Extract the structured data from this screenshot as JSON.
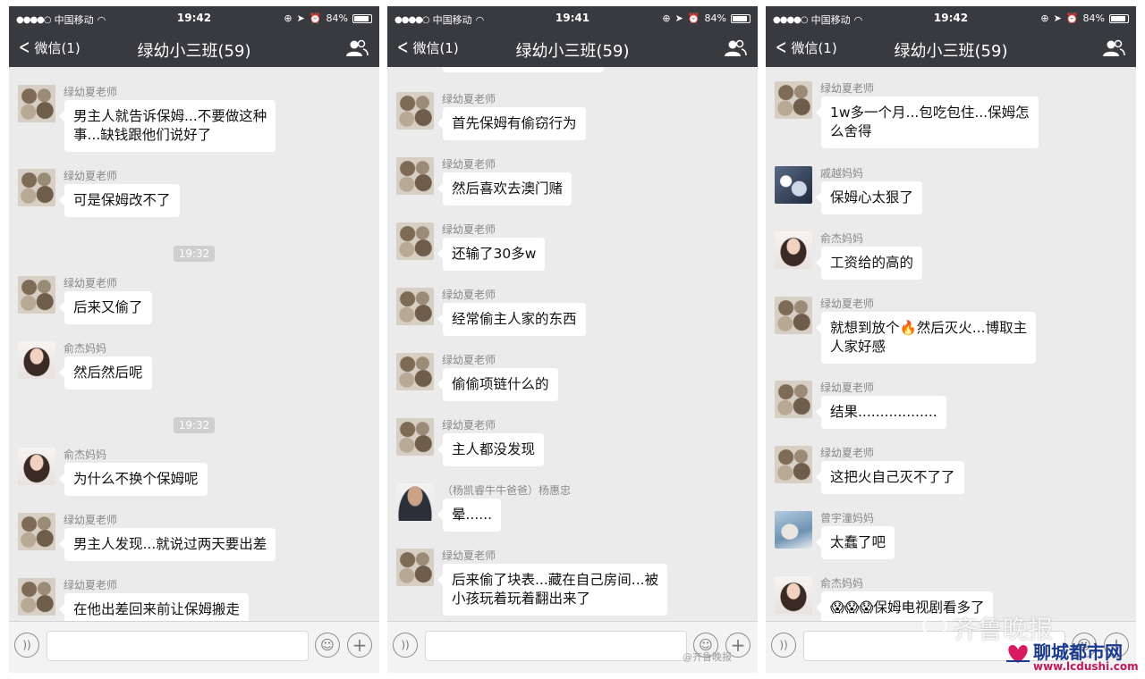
{
  "phones": [
    {
      "status": {
        "carrier": "中国移动",
        "time": "19:42",
        "battery": "84%"
      },
      "nav": {
        "back_label": "微信(1)",
        "title": "绿幼小三班(59)"
      },
      "messages": [
        {
          "kind": "msg",
          "sender": "绿幼夏老师",
          "avatar": "teacher",
          "lines": [
            "男主人就告诉保姆...不要做这种",
            "事...缺钱跟他们说好了"
          ]
        },
        {
          "kind": "msg",
          "sender": "绿幼夏老师",
          "avatar": "teacher",
          "lines": [
            "可是保姆改不了"
          ]
        },
        {
          "kind": "time",
          "text": "19:32"
        },
        {
          "kind": "msg",
          "sender": "绿幼夏老师",
          "avatar": "teacher",
          "lines": [
            "后来又偷了"
          ]
        },
        {
          "kind": "msg",
          "sender": "俞杰妈妈",
          "avatar": "yu",
          "lines": [
            "然后然后呢"
          ]
        },
        {
          "kind": "time",
          "text": "19:32"
        },
        {
          "kind": "msg",
          "sender": "俞杰妈妈",
          "avatar": "yu",
          "lines": [
            "为什么不换个保姆呢"
          ]
        },
        {
          "kind": "msg",
          "sender": "绿幼夏老师",
          "avatar": "teacher",
          "lines": [
            "男主人发现...就说过两天要出差"
          ]
        },
        {
          "kind": "msg",
          "sender": "绿幼夏老师",
          "avatar": "teacher",
          "lines": [
            "在他出差回来前让保姆搬走"
          ]
        }
      ]
    },
    {
      "status": {
        "carrier": "中国移动",
        "time": "19:41",
        "battery": "84%"
      },
      "nav": {
        "back_label": "微信(1)",
        "title": "绿幼小三班(59)"
      },
      "messages": [
        {
          "kind": "msg",
          "sender": "绿幼夏老师",
          "avatar": "teacher",
          "lines": [
            "首先保姆有偷窃行为"
          ]
        },
        {
          "kind": "msg",
          "sender": "绿幼夏老师",
          "avatar": "teacher",
          "lines": [
            "然后喜欢去澳门赌"
          ]
        },
        {
          "kind": "msg",
          "sender": "绿幼夏老师",
          "avatar": "teacher",
          "lines": [
            "还输了30多w"
          ]
        },
        {
          "kind": "msg",
          "sender": "绿幼夏老师",
          "avatar": "teacher",
          "lines": [
            "经常偷主人家的东西"
          ]
        },
        {
          "kind": "msg",
          "sender": "绿幼夏老师",
          "avatar": "teacher",
          "lines": [
            "偷偷项链什么的"
          ]
        },
        {
          "kind": "msg",
          "sender": "绿幼夏老师",
          "avatar": "teacher",
          "lines": [
            "主人都没发现"
          ]
        },
        {
          "kind": "msg",
          "sender": "（杨凯睿牛牛爸爸）杨惠忠",
          "avatar": "yang",
          "lines": [
            "晕......"
          ]
        },
        {
          "kind": "msg",
          "sender": "绿幼夏老师",
          "avatar": "teacher",
          "lines": [
            "后来偷了块表...藏在自己房间...被",
            "小孩玩着玩着翻出来了"
          ]
        }
      ]
    },
    {
      "status": {
        "carrier": "中国移动",
        "time": "19:42",
        "battery": "84%"
      },
      "nav": {
        "back_label": "微信(1)",
        "title": "绿幼小三班(59)"
      },
      "messages": [
        {
          "kind": "msg",
          "sender": "绿幼夏老师",
          "avatar": "teacher",
          "lines": [
            "1w多一个月...包吃包住...保姆怎",
            "么舍得"
          ]
        },
        {
          "kind": "msg",
          "sender": "戚越妈妈",
          "avatar": "qi",
          "lines": [
            "保姆心太狠了"
          ]
        },
        {
          "kind": "msg",
          "sender": "俞杰妈妈",
          "avatar": "yu",
          "lines": [
            "工资给的高的"
          ]
        },
        {
          "kind": "msg",
          "sender": "绿幼夏老师",
          "avatar": "teacher",
          "lines": [
            "就想到放个🔥然后灭火...博取主",
            "人家好感"
          ]
        },
        {
          "kind": "msg",
          "sender": "绿幼夏老师",
          "avatar": "teacher",
          "lines": [
            "结果.................."
          ]
        },
        {
          "kind": "msg",
          "sender": "绿幼夏老师",
          "avatar": "teacher",
          "lines": [
            "这把火自己灭不了了"
          ]
        },
        {
          "kind": "msg",
          "sender": "曾宇潼妈妈",
          "avatar": "zeng",
          "lines": [
            "太蠢了吧"
          ]
        },
        {
          "kind": "msg",
          "sender": "俞杰妈妈",
          "avatar": "yu",
          "lines": [
            "😱😱😱保姆电视剧看多了"
          ]
        }
      ]
    }
  ],
  "watermarks": {
    "weibo": "@齐鲁晚报",
    "qilu": "齐鲁晚报",
    "lc_name": "聊城都市网",
    "lc_url": "www.lcdushi.com"
  }
}
